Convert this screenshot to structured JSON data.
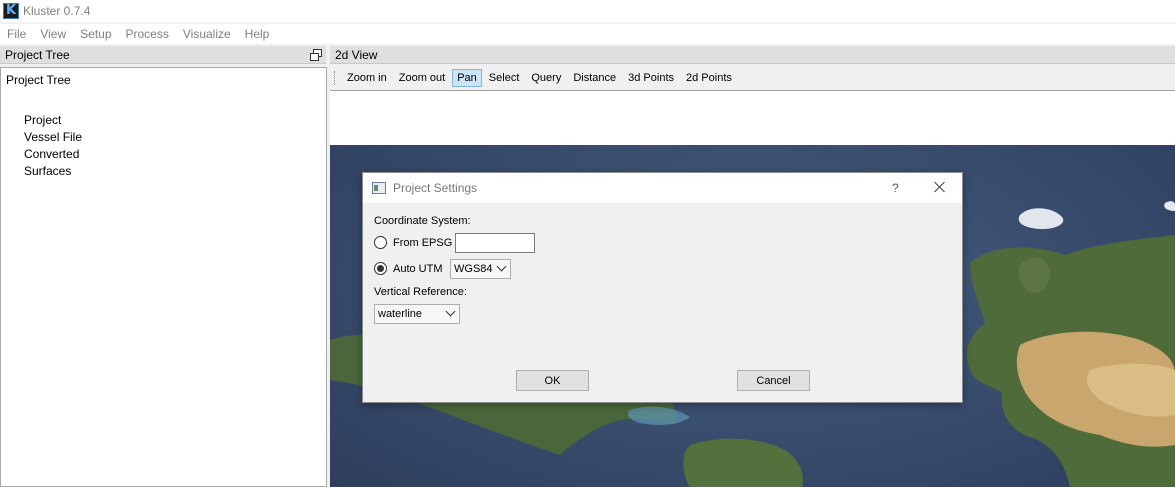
{
  "window": {
    "title": "Kluster 0.7.4"
  },
  "menu": [
    "File",
    "View",
    "Setup",
    "Process",
    "Visualize",
    "Help"
  ],
  "project_tree": {
    "dock_title": "Project Tree",
    "root": "Project Tree",
    "children": [
      "Project",
      "Vessel File",
      "Converted",
      "Surfaces"
    ]
  },
  "view2d": {
    "dock_title": "2d View",
    "tools": [
      "Zoom in",
      "Zoom out",
      "Pan",
      "Select",
      "Query",
      "Distance",
      "3d Points",
      "2d Points"
    ],
    "active_tool": "Pan"
  },
  "dialog": {
    "title": "Project Settings",
    "help": "?",
    "coordinate_label": "Coordinate System:",
    "from_epsg_label": "From EPSG",
    "epsg_value": "",
    "auto_utm_label": "Auto UTM",
    "auto_utm_checked": true,
    "datum_value": "WGS84",
    "vertical_label": "Vertical Reference:",
    "vertical_value": "waterline",
    "ok_label": "OK",
    "cancel_label": "Cancel"
  }
}
